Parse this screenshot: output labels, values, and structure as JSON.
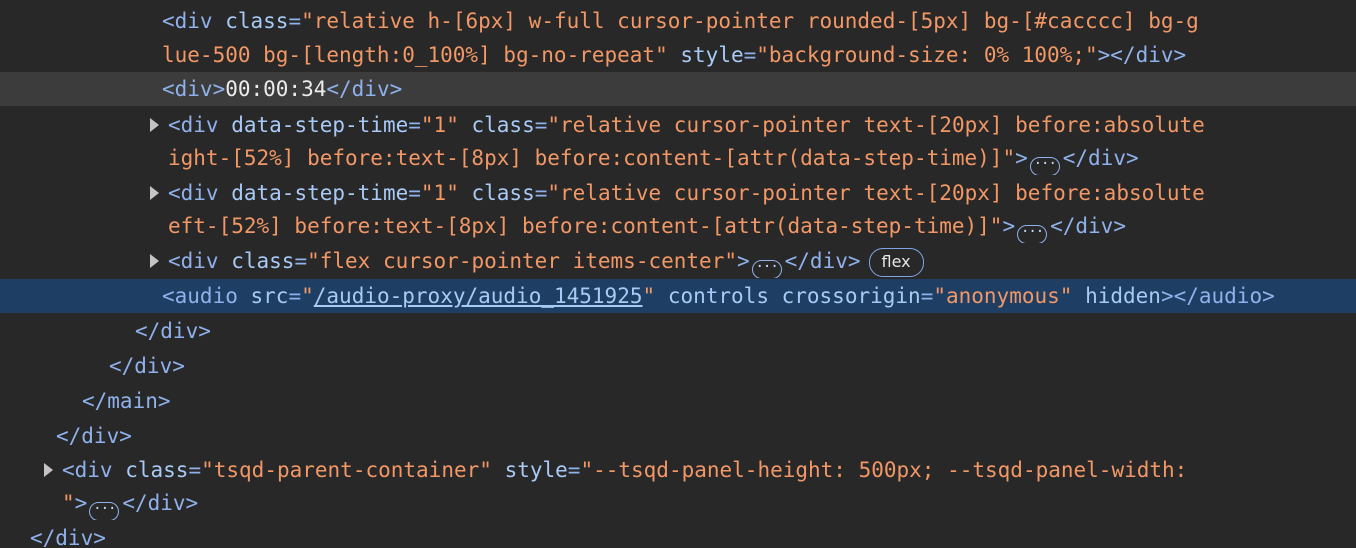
{
  "dom_tree": {
    "lines": [
      {
        "id": "progress-div-open",
        "tokens": [
          {
            "k": "tag",
            "t": "<div"
          },
          {
            "k": "t",
            "t": " "
          },
          {
            "k": "attr",
            "t": "class"
          },
          {
            "k": "tag",
            "t": "="
          },
          {
            "k": "val",
            "t": "\"relative h-[6px] w-full cursor-pointer rounded-[5px] bg-[#cacccc] bg-g"
          }
        ]
      },
      {
        "id": "progress-div-wrap",
        "tokens": [
          {
            "k": "val",
            "t": "lue-500 bg-[length:0_100%] bg-no-repeat\""
          },
          {
            "k": "t",
            "t": " "
          },
          {
            "k": "attr",
            "t": "style"
          },
          {
            "k": "tag",
            "t": "="
          },
          {
            "k": "val",
            "t": "\"background-size: 0% 100%;\""
          },
          {
            "k": "tag",
            "t": "></div>"
          }
        ]
      },
      {
        "id": "timer-div",
        "tokens": [
          {
            "k": "tag",
            "t": "<div>"
          },
          {
            "k": "txt",
            "t": "00:00:34"
          },
          {
            "k": "tag",
            "t": "</div>"
          }
        ]
      },
      {
        "id": "step-back-div",
        "tokens": [
          {
            "k": "tag",
            "t": "<div"
          },
          {
            "k": "t",
            "t": " "
          },
          {
            "k": "attr",
            "t": "data-step-time"
          },
          {
            "k": "tag",
            "t": "="
          },
          {
            "k": "val",
            "t": "\"1\""
          },
          {
            "k": "t",
            "t": " "
          },
          {
            "k": "attr",
            "t": "class"
          },
          {
            "k": "tag",
            "t": "="
          },
          {
            "k": "val",
            "t": "\"relative cursor-pointer text-[20px] before:absolute"
          }
        ]
      },
      {
        "id": "step-back-div-wrap",
        "tokens": [
          {
            "k": "val",
            "t": "ight-[52%] before:text-[8px] before:content-[attr(data-step-time)]\""
          },
          {
            "k": "tag",
            "t": ">"
          },
          {
            "k": "ell",
            "t": "···"
          },
          {
            "k": "tag",
            "t": "</div>"
          }
        ]
      },
      {
        "id": "step-forward-div",
        "tokens": [
          {
            "k": "tag",
            "t": "<div"
          },
          {
            "k": "t",
            "t": " "
          },
          {
            "k": "attr",
            "t": "data-step-time"
          },
          {
            "k": "tag",
            "t": "="
          },
          {
            "k": "val",
            "t": "\"1\""
          },
          {
            "k": "t",
            "t": " "
          },
          {
            "k": "attr",
            "t": "class"
          },
          {
            "k": "tag",
            "t": "="
          },
          {
            "k": "val",
            "t": "\"relative cursor-pointer text-[20px] before:absolute"
          }
        ]
      },
      {
        "id": "step-forward-div-wrap",
        "tokens": [
          {
            "k": "val",
            "t": "eft-[52%] before:text-[8px] before:content-[attr(data-step-time)]\""
          },
          {
            "k": "tag",
            "t": ">"
          },
          {
            "k": "ell",
            "t": "···"
          },
          {
            "k": "tag",
            "t": "</div>"
          }
        ]
      },
      {
        "id": "flex-div",
        "tokens": [
          {
            "k": "tag",
            "t": "<div"
          },
          {
            "k": "t",
            "t": " "
          },
          {
            "k": "attr",
            "t": "class"
          },
          {
            "k": "tag",
            "t": "="
          },
          {
            "k": "val",
            "t": "\"flex cursor-pointer items-center\""
          },
          {
            "k": "tag",
            "t": ">"
          },
          {
            "k": "ell",
            "t": "···"
          },
          {
            "k": "tag",
            "t": "</div>"
          },
          {
            "k": "badge",
            "t": "flex"
          }
        ]
      },
      {
        "id": "audio-element",
        "tokens": [
          {
            "k": "tag",
            "t": "<audio"
          },
          {
            "k": "t",
            "t": " "
          },
          {
            "k": "attr",
            "t": "src"
          },
          {
            "k": "tag",
            "t": "="
          },
          {
            "k": "val",
            "t": "\""
          },
          {
            "k": "link",
            "t": "/audio-proxy/audio_1451925"
          },
          {
            "k": "val",
            "t": "\""
          },
          {
            "k": "t",
            "t": " "
          },
          {
            "k": "attr",
            "t": "controls crossorigin"
          },
          {
            "k": "tag",
            "t": "="
          },
          {
            "k": "val",
            "t": "\"anonymous\""
          },
          {
            "k": "t",
            "t": " "
          },
          {
            "k": "attr",
            "t": "hidden"
          },
          {
            "k": "tag",
            "t": "></audio>"
          }
        ]
      },
      {
        "id": "close-div-1",
        "tokens": [
          {
            "k": "tag",
            "t": "</div>"
          }
        ]
      },
      {
        "id": "close-div-2",
        "tokens": [
          {
            "k": "tag",
            "t": "</div>"
          }
        ]
      },
      {
        "id": "close-main",
        "tokens": [
          {
            "k": "tag",
            "t": "</main>"
          }
        ]
      },
      {
        "id": "close-div-3",
        "tokens": [
          {
            "k": "tag",
            "t": "</div>"
          }
        ]
      },
      {
        "id": "tsqd-container",
        "tokens": [
          {
            "k": "tag",
            "t": "<div"
          },
          {
            "k": "t",
            "t": " "
          },
          {
            "k": "attr",
            "t": "class"
          },
          {
            "k": "tag",
            "t": "="
          },
          {
            "k": "val",
            "t": "\"tsqd-parent-container\""
          },
          {
            "k": "t",
            "t": " "
          },
          {
            "k": "attr",
            "t": "style"
          },
          {
            "k": "tag",
            "t": "="
          },
          {
            "k": "val",
            "t": "\"--tsqd-panel-height: 500px; --tsqd-panel-width:"
          }
        ]
      },
      {
        "id": "tsqd-container-wrap",
        "tokens": [
          {
            "k": "val",
            "t": "\""
          },
          {
            "k": "tag",
            "t": ">"
          },
          {
            "k": "ell",
            "t": "···"
          },
          {
            "k": "tag",
            "t": "</div>"
          }
        ]
      },
      {
        "id": "close-div-4",
        "tokens": [
          {
            "k": "tag",
            "t": "</div>"
          }
        ]
      }
    ]
  }
}
